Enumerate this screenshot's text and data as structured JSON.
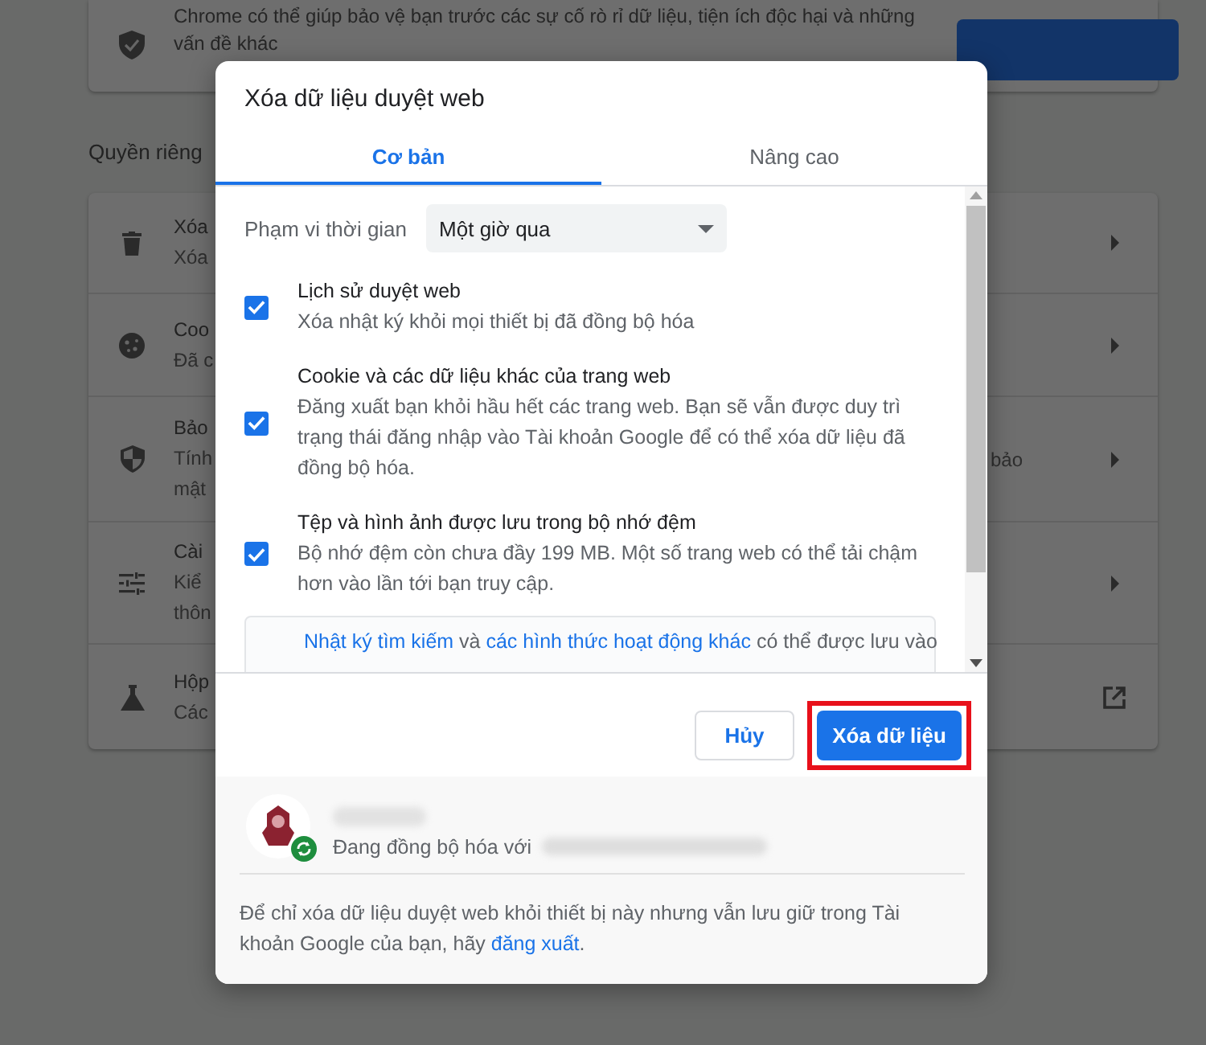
{
  "background": {
    "top_card": {
      "lines": [
        "Chrome có thể giúp bảo vệ bạn trước các sự cố rò rỉ dữ liệu, tiện ích độc hại và những",
        "vấn đề khác"
      ]
    },
    "section_title": "Quyền riêng",
    "rows": [
      {
        "kind": "submenu",
        "title": "Xóa",
        "lines": [
          "Xóa"
        ]
      },
      {
        "kind": "submenu",
        "title": "Coo",
        "lines": [
          "Đã c"
        ]
      },
      {
        "kind": "submenu",
        "title": "Bảo",
        "lines": [
          "Tính",
          "mật"
        ],
        "line_end": "bảo"
      },
      {
        "kind": "submenu",
        "title": "Cài",
        "lines": [
          "Kiể",
          "thôn"
        ]
      },
      {
        "kind": "external",
        "title": "Hộp",
        "lines": [
          "Các"
        ]
      }
    ]
  },
  "dialog": {
    "title": "Xóa dữ liệu duyệt web",
    "tabs": [
      {
        "label": "Cơ bản",
        "selected": true
      },
      {
        "label": "Nâng cao",
        "selected": false
      }
    ],
    "time_range": {
      "label": "Phạm vi thời gian",
      "value": "Một giờ qua"
    },
    "options": [
      {
        "title": "Lịch sử duyệt web",
        "description": "Xóa nhật ký khỏi mọi thiết bị đã đồng bộ hóa",
        "checked": true
      },
      {
        "title": "Cookie và các dữ liệu khác của trang web",
        "description": "Đăng xuất bạn khỏi hầu hết các trang web. Bạn sẽ vẫn được duy trì trạng thái đăng nhập vào Tài khoản Google để có thể xóa dữ liệu đã đồng bộ hóa.",
        "checked": true
      },
      {
        "title": "Tệp và hình ảnh được lưu trong bộ nhớ đệm",
        "description": "Bộ nhớ đệm còn chưa đầy 199 MB. Một số trang web có thể tải chậm hơn vào lần tới bạn truy cập.",
        "checked": true
      }
    ],
    "info": {
      "link_1": "Nhật ký tìm kiếm",
      "text_1": " và ",
      "link_2": "các hình thức hoạt động khác",
      "text_2": " có thể được lưu vào"
    },
    "buttons": [
      {
        "label": "Hủy",
        "kind": "secondary",
        "highlighted": false
      },
      {
        "label": "Xóa dữ liệu",
        "kind": "primary",
        "highlighted": true
      }
    ],
    "account": {
      "status": "Đang đồng bộ hóa với"
    },
    "footer": {
      "text": "Để chỉ xóa dữ liệu duyệt web khỏi thiết bị này nhưng vẫn lưu giữ trong Tài khoản Google của bạn, hãy ",
      "link": "đăng xuất",
      "end": "."
    }
  }
}
